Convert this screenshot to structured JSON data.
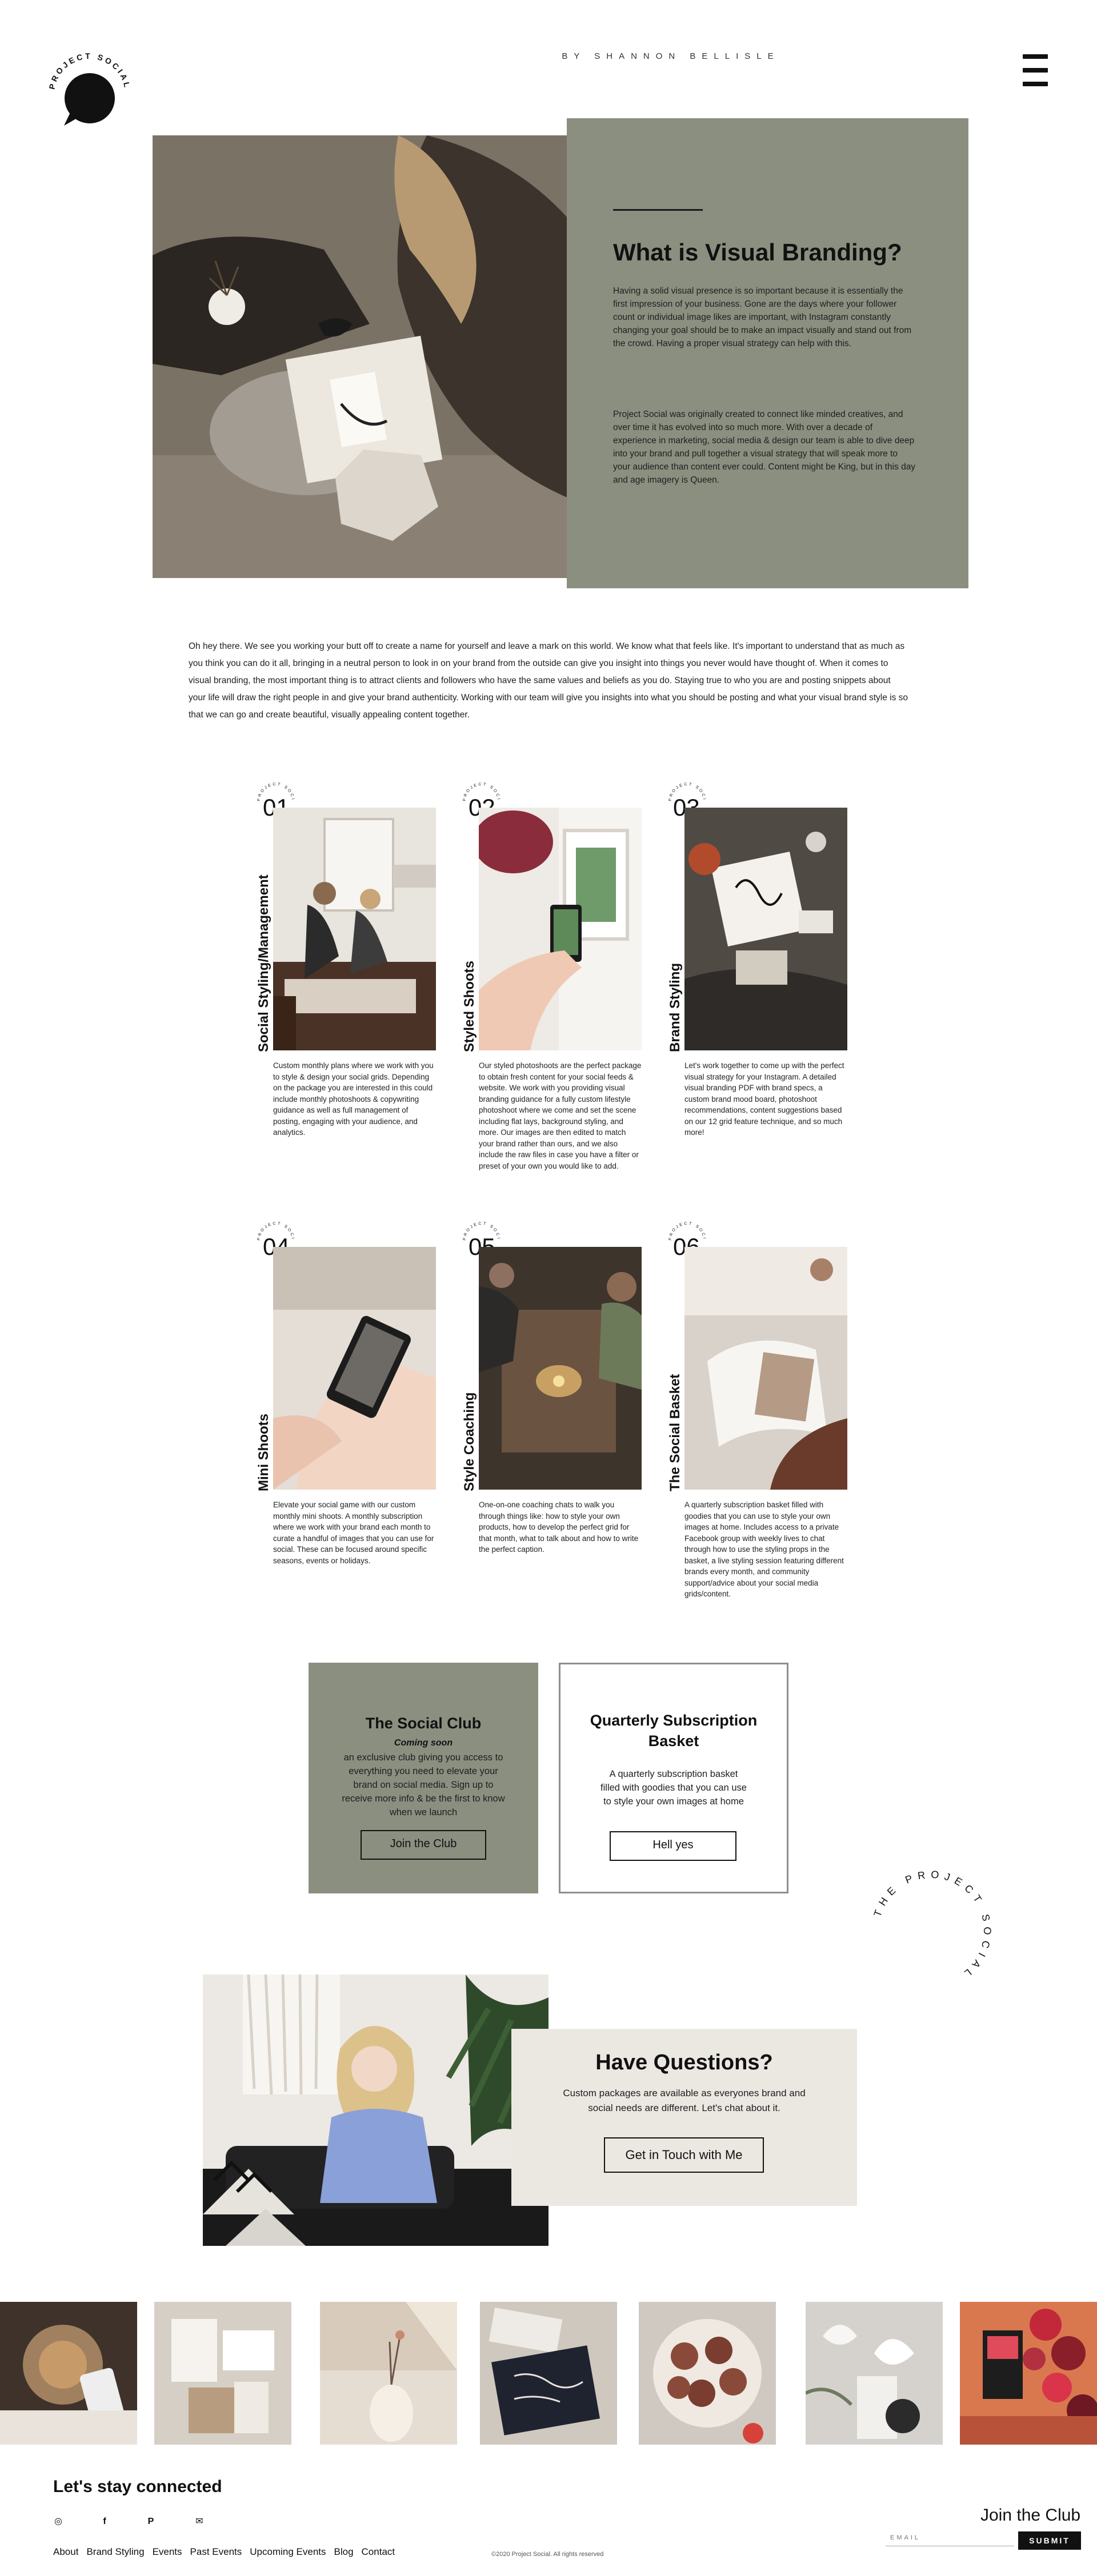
{
  "header": {
    "logo_text": "PROJECT SOCIAL",
    "byline": "BY SHANNON BELLISLE",
    "menu_icon": "hamburger-menu-icon"
  },
  "hero": {
    "title": "What is Visual Branding?",
    "paragraph_1": "Having a solid visual presence is so important because it is essentially the first impression of your business. Gone are the days where your follower count or individual image likes are important, with Instagram constantly changing your goal should be to make an impact visually and stand out from the crowd. Having a proper visual strategy can help with this.",
    "paragraph_2": "Project Social  was originally created to connect like minded creatives, and over time it has evolved into so much more. With over a decade of experience in marketing, social media & design our team is able to dive deep into your brand and pull together a visual strategy that will speak more to your audience than content ever could. Content might be King, but in this day and age imagery is Queen."
  },
  "intro": "Oh hey there. We see you working your butt off to create a name for yourself and leave a mark on this world. We know what that feels like. It's important to understand that as much as you think you can do it all, bringing in a neutral person to look in on your brand from the outside can give you insight into things you never would have thought of. When it comes to visual branding, the most important thing is to attract clients and followers who have the same values and beliefs as you do. Staying true to who you are and posting snippets about your life will draw the right people in and give your brand authenticity. Working with our team will give you insights into what you should be posting and what your visual brand style is so that we can go and create beautiful, visually appealing content together.",
  "services": [
    {
      "number": "01",
      "ring_text": "PROJECT SOCIAL",
      "title": "Social Styling/Management",
      "description": "Custom monthly plans where we work with you to style & design your social grids. Depending on the package you are interested in this could include monthly photoshoots & copywriting guidance as well as full management of posting, engaging with your audience, and analytics."
    },
    {
      "number": "02",
      "ring_text": "PROJECT SOCIAL",
      "title": "Styled Shoots",
      "description": "Our styled photoshoots are the perfect package to obtain fresh content for your social feeds & website. We work with you providing visual branding guidance for a fully custom lifestyle photoshoot where we come and set the scene including flat lays, background styling, and more. Our images are then edited to match your brand rather than ours, and we also include the raw files in case you have a filter or preset of your own you would like to add."
    },
    {
      "number": "03",
      "ring_text": "PROJECT SOCIAL",
      "title": "Brand Styling",
      "description": "Let's work together to come up with the perfect visual strategy for your Instagram. A detailed visual branding PDF with brand specs, a custom brand mood board, photoshoot recommendations, content suggestions based on our 12 grid feature technique, and so much more!"
    },
    {
      "number": "04",
      "ring_text": "PROJECT SOCIAL",
      "title": "Mini Shoots",
      "description": "Elevate your social game with our custom monthly mini shoots. A monthly subscription where we work with your brand each month to curate a handful of images that you can use for social. These can be focused around specific seasons, events or holidays."
    },
    {
      "number": "05",
      "ring_text": "PROJECT SOCIAL",
      "title": "Style Coaching",
      "description": "One-on-one coaching chats to walk you through things like: how to style your own products, how to develop the perfect grid for that month, what to talk about and how to write the perfect caption."
    },
    {
      "number": "06",
      "ring_text": "PROJECT SOCIAL",
      "title": "The Social Basket",
      "description": "A quarterly subscription basket filled with goodies that you can use to style your own images at home. Includes access to a private Facebook group with weekly lives to chat through how to use the styling props in the basket, a live styling session featuring different brands every month, and community support/advice about your social media grids/content."
    }
  ],
  "club_card": {
    "title": "The Social Club",
    "subtitle": "Coming soon",
    "text": "an exclusive club giving you access to everything you need to elevate your brand on social media. Sign up to receive more info & be the first to know when we launch",
    "button": "Join the Club"
  },
  "basket_card": {
    "title": "Quarterly Subscription Basket",
    "text": "A quarterly subscription basket filled with goodies that you can use to style your own images at home",
    "button": "Hell yes"
  },
  "circle_badge": "THE PROJECT SOCIAL",
  "questions": {
    "title": "Have Questions?",
    "text": "Custom packages are available as everyones brand and social needs are different. Let's chat about it.",
    "button": "Get in Touch with Me"
  },
  "footer": {
    "title": "Let's stay connected",
    "social_icons": [
      "instagram-icon",
      "facebook-icon",
      "pinterest-icon",
      "email-icon"
    ],
    "social_glyphs": [
      "◎",
      "f",
      "P",
      "✉"
    ],
    "nav": [
      "About",
      "Brand Styling",
      "Events",
      "Past Events",
      "Upcoming Events",
      "Blog",
      "Contact"
    ],
    "copyright": "©2020 Project Social. All rights reserved",
    "join_title": "Join the Club",
    "email_placeholder": "EMAIL",
    "submit": "SUBMIT"
  },
  "colors": {
    "sage": "#8b8f80",
    "cream": "#ebe8e2",
    "ink": "#111111"
  }
}
